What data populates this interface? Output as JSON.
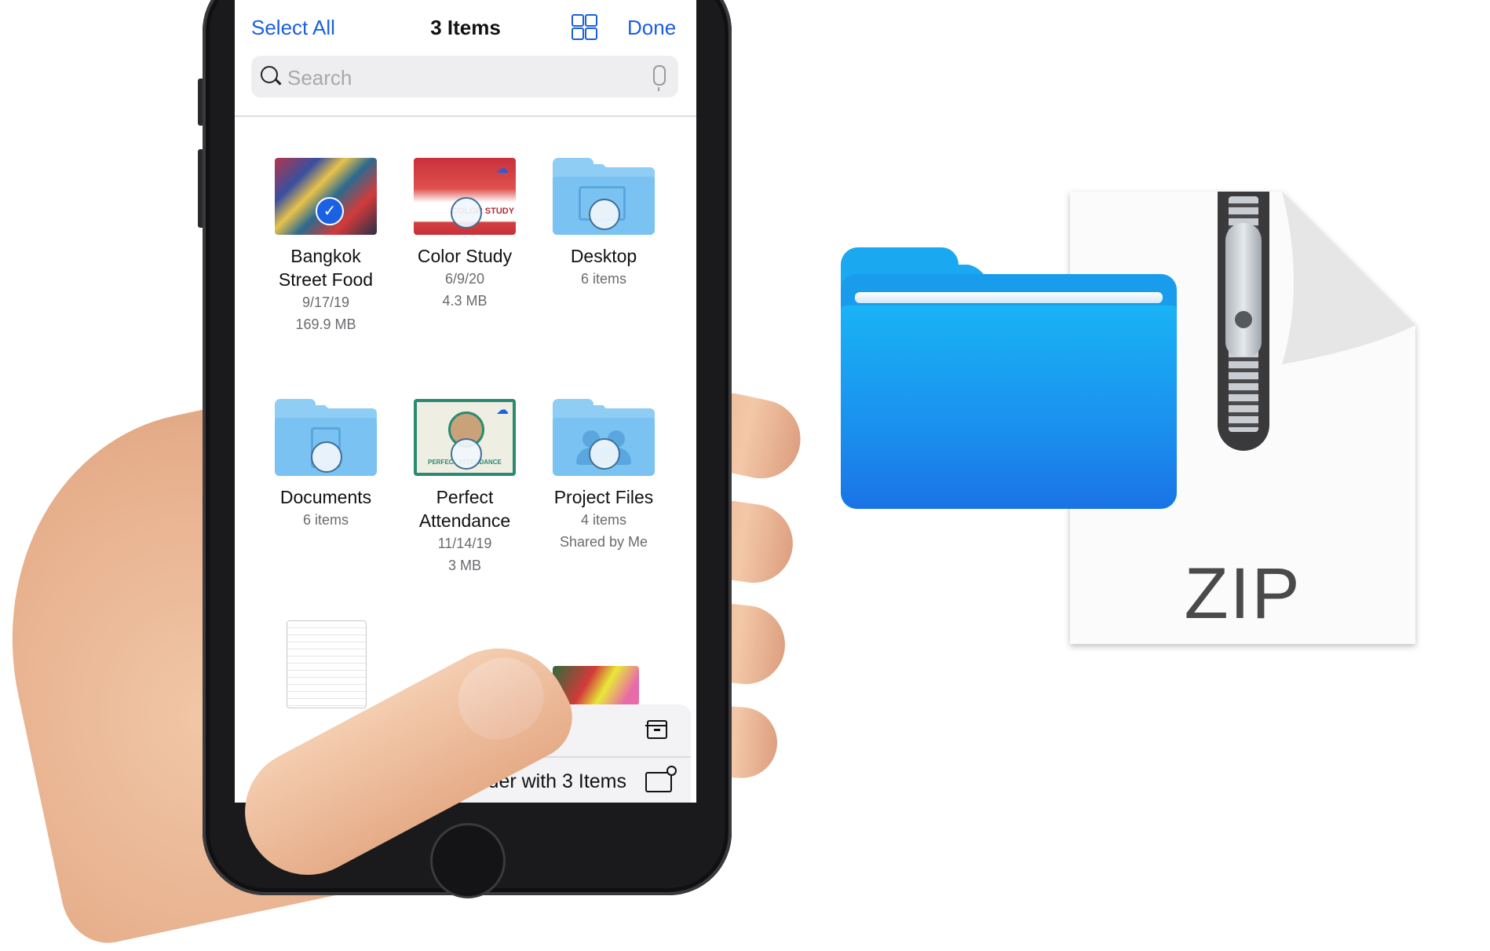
{
  "nav": {
    "select_all": "Select All",
    "title": "3 Items",
    "view_toggle_icon": "grid-icon",
    "done": "Done"
  },
  "search": {
    "placeholder": "Search",
    "search_icon": "magnifier-icon",
    "mic_icon": "microphone-icon"
  },
  "items": [
    {
      "name_line1": "Bangkok",
      "name_line2": "Street Food",
      "meta1": "9/17/19",
      "meta2": "169.9 MB",
      "type": "photo",
      "selected": true
    },
    {
      "name_line1": "Color Study",
      "name_line2": "",
      "meta1": "6/9/20",
      "meta2": "4.3 MB",
      "type": "document",
      "cloud": true,
      "thumb_text": "COLOR STUDY"
    },
    {
      "name_line1": "Desktop",
      "name_line2": "",
      "meta1": "6 items",
      "meta2": "",
      "type": "folder"
    },
    {
      "name_line1": "Documents",
      "name_line2": "",
      "meta1": "6 items",
      "meta2": "",
      "type": "folder"
    },
    {
      "name_line1": "Perfect",
      "name_line2": "Attendance",
      "meta1": "11/14/19",
      "meta2": "3 MB",
      "type": "document",
      "cloud": true,
      "thumb_text": "PERFECT ATTENDANCE"
    },
    {
      "name_line1": "Project Files",
      "name_line2": "",
      "meta1": "4 items",
      "meta2": "Shared by Me",
      "type": "shared-folder"
    }
  ],
  "action_sheet": {
    "compress_icon": "archive-box-icon",
    "new_folder_label": "New Folder with 3 Items",
    "new_folder_icon": "folder-badge-plus-icon"
  },
  "illustration": {
    "zip_label": "ZIP"
  },
  "colors": {
    "ios_blue": "#1a5fe0",
    "folder_light": "#8fcdf5",
    "big_folder_blue": "#1a9ced"
  }
}
